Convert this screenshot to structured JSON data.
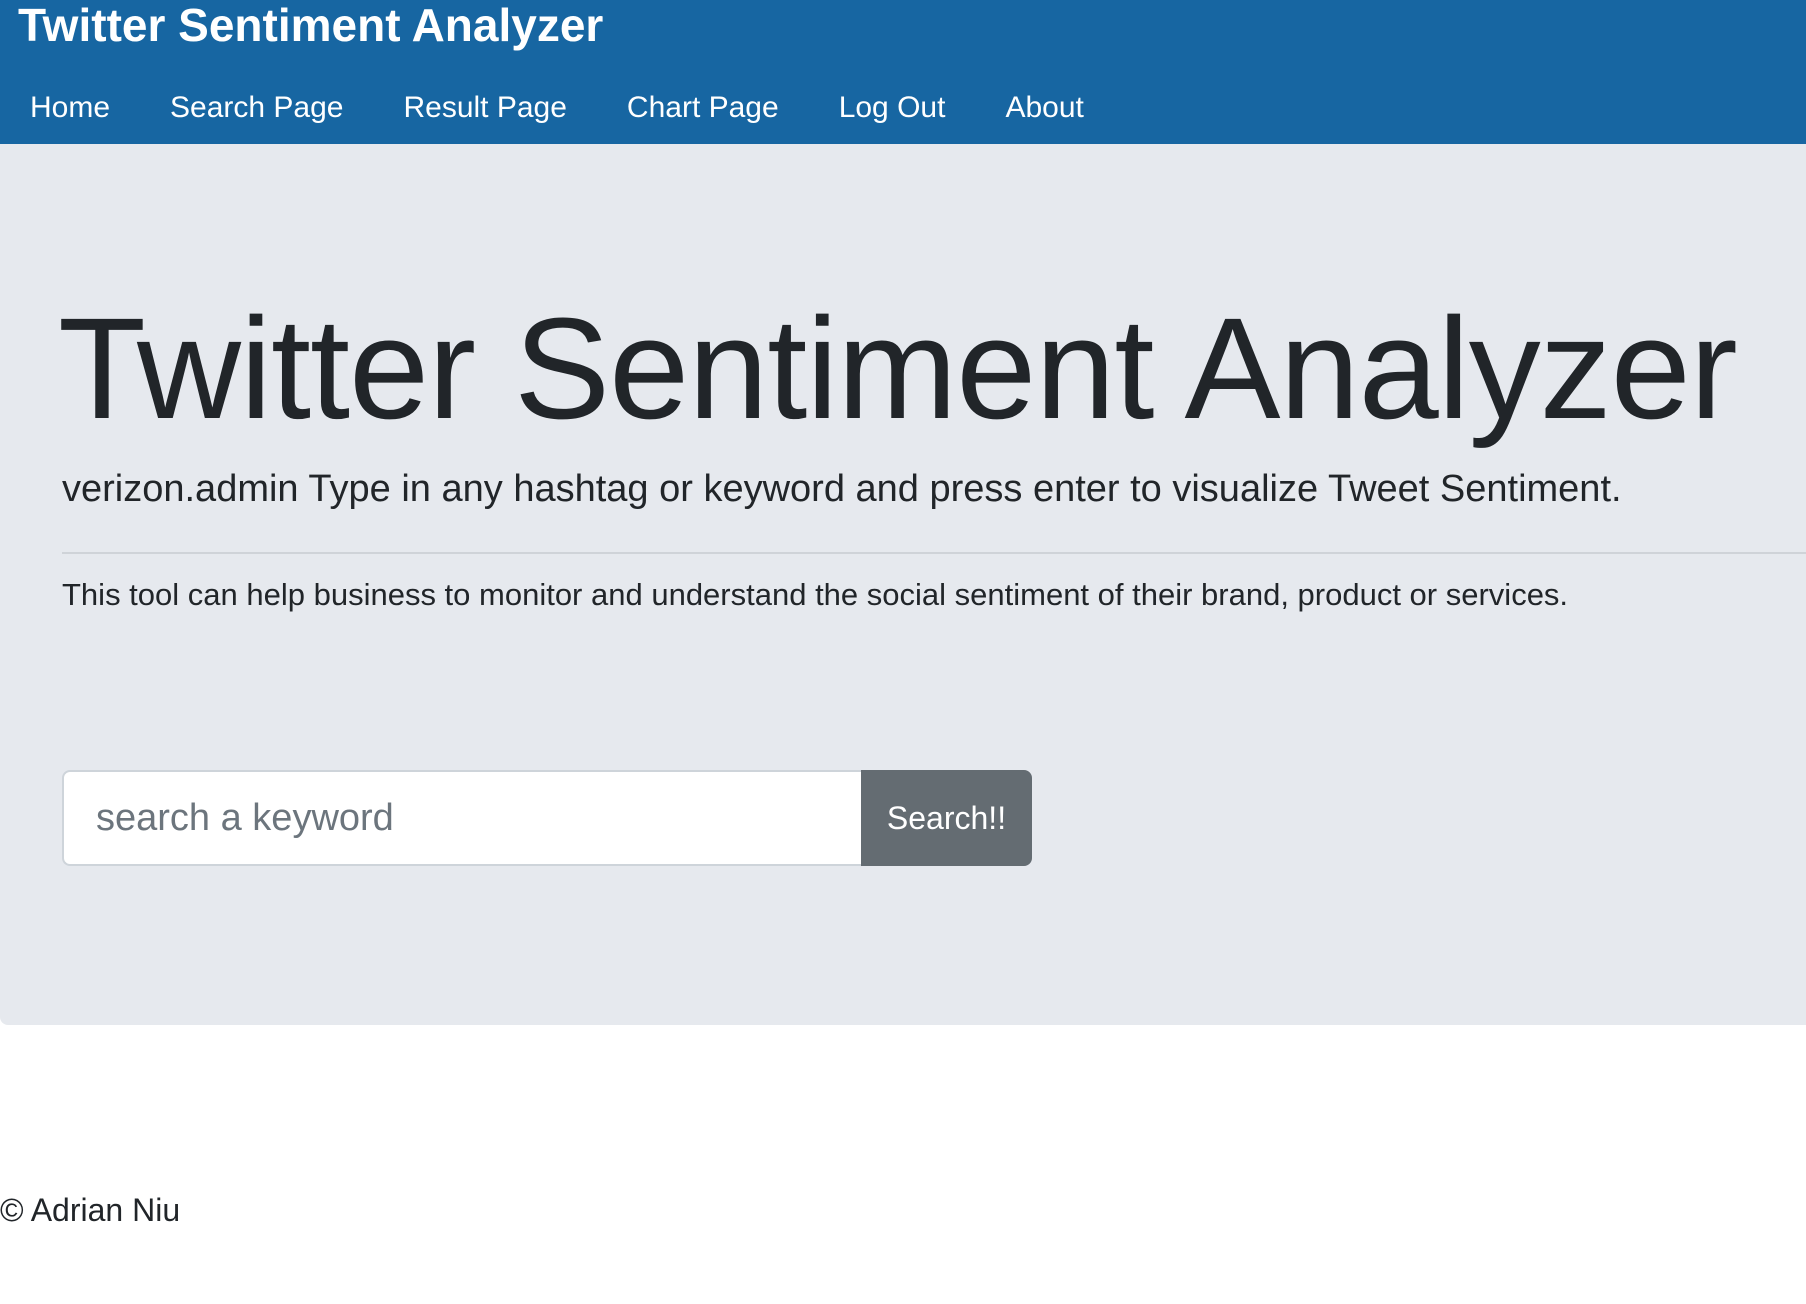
{
  "navbar": {
    "brand": "Twitter Sentiment Analyzer",
    "links": [
      {
        "label": "Home"
      },
      {
        "label": "Search Page"
      },
      {
        "label": "Result Page"
      },
      {
        "label": "Chart Page"
      },
      {
        "label": "Log Out"
      },
      {
        "label": "About"
      }
    ]
  },
  "jumbotron": {
    "title": "Twitter Sentiment Analyzer",
    "lead": "verizon.admin Type in any hashtag or keyword and press enter to visualize Tweet Sentiment.",
    "description": "This tool can help business to monitor and understand the social sentiment of their brand, product or services."
  },
  "search": {
    "placeholder": "search a keyword",
    "value": "",
    "button_label": "Search!!"
  },
  "footer": {
    "text": "© Adrian Niu"
  },
  "colors": {
    "navbar_bg": "#1766a2",
    "jumbotron_bg": "#e6e9ee",
    "button_bg": "#646c72"
  }
}
